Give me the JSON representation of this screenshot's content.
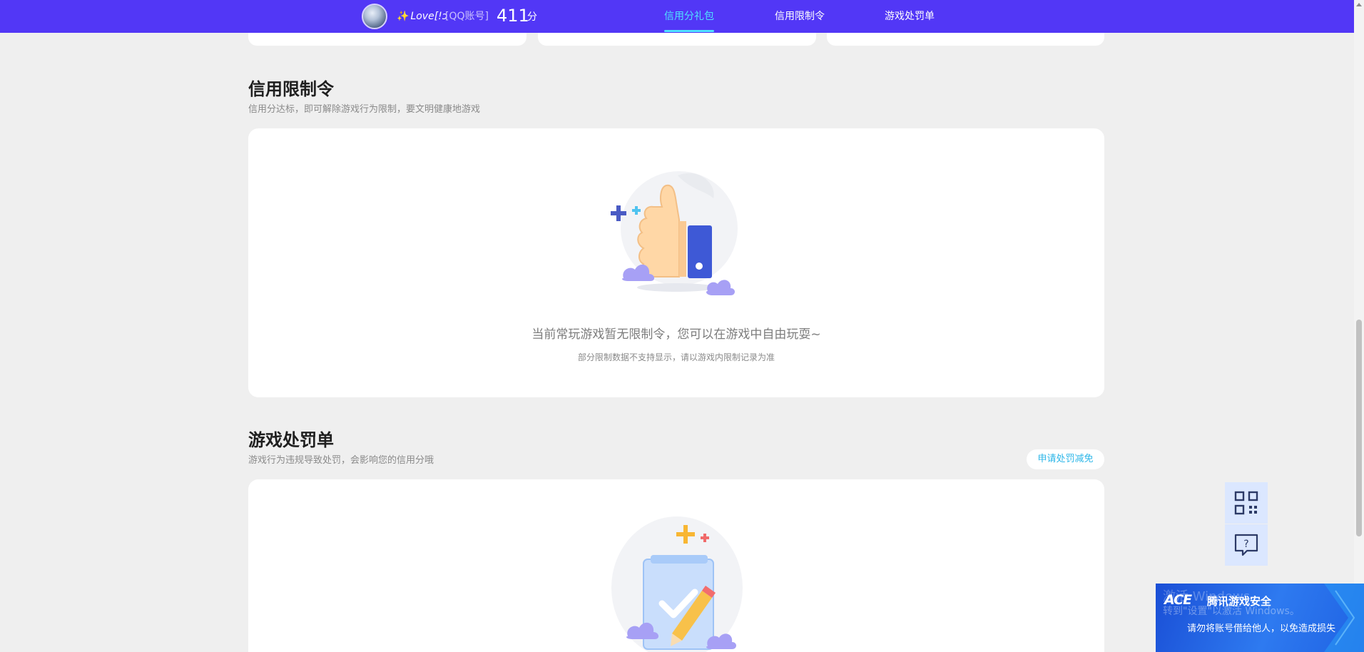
{
  "header": {
    "username": "Love[!ɔ",
    "account_type": "[QQ账号]",
    "score": "411",
    "score_unit": "分",
    "tabs": [
      {
        "label": "信用分礼包",
        "active": true
      },
      {
        "label": "信用限制令",
        "active": false
      },
      {
        "label": "游戏处罚单",
        "active": false
      }
    ]
  },
  "restriction": {
    "title": "信用限制令",
    "subtitle": "信用分达标，即可解除游戏行为限制，要文明健康地游戏",
    "empty_text": "当前常玩游戏暂无限制令，您可以在游戏中自由玩耍~",
    "empty_note": "部分限制数据不支持显示，请以游戏内限制记录为准"
  },
  "penalty": {
    "title": "游戏处罚单",
    "subtitle": "游戏行为违规导致处罚，会影响您的信用分哦",
    "appeal_button": "申请处罚减免"
  },
  "float_tools": [
    {
      "icon": "qr-code-icon"
    },
    {
      "icon": "help-chat-icon"
    }
  ],
  "banner": {
    "logo": "ACE",
    "title": "腾讯游戏安全",
    "text": "请勿将账号借给他人，以免造成损失",
    "watermark_line1": "激活 Windows",
    "watermark_line2": "转到\"设置\"以激活 Windows。"
  },
  "colors": {
    "topbar": "#5237f6",
    "active_tab": "#4fe2ff",
    "background": "#efefef",
    "link": "#2bb6e8"
  }
}
